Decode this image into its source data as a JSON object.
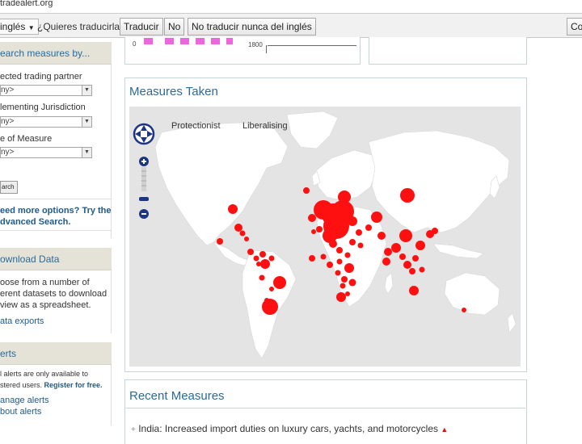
{
  "url": "tradealert.org",
  "translate_bar": {
    "language": "inglés",
    "question": "¿Quieres traducirla?",
    "translate_button": "Traducir",
    "no_button": "No",
    "never_button": "No traducir nunca del inglés",
    "right_button": "Con"
  },
  "sidebar": {
    "search_header": "earch measures by...",
    "trading_partner_label": "ected trading partner",
    "trading_partner_value": "ny>",
    "jurisdiction_label": "lementing Jurisdiction",
    "jurisdiction_value": "ny>",
    "type_label": "e of Measure",
    "type_value": "ny>",
    "search_button": "arch",
    "more_options_line1": "eed more options? Try the",
    "more_options_line2": "dvanced Search.",
    "download_header": "ownload Data",
    "download_text_1": "oose from a number of",
    "download_text_2": "erent datasets to download",
    "download_text_3": "view as a spreadsheet.",
    "data_exports_link": "ata exports",
    "alerts_header": "erts",
    "alerts_text_1": "l alerts are only available to",
    "alerts_text_2a": "stered users. ",
    "alerts_text_2b": "Register for free.",
    "manage_alerts_link": "anage alerts",
    "about_alerts_link": "bout alerts"
  },
  "top_chart": {
    "axis_left": "0",
    "axis_right": "1800",
    "bar_color": "#ee66dd"
  },
  "measures_taken": {
    "title": "Measures Taken",
    "legend_protectionist": "Protectionist",
    "legend_liberalising": "Liberalising",
    "marker_color": "#ff1010",
    "map_background": "#e4e4e4",
    "land_color": "#ffffff"
  },
  "recent_measures": {
    "title": "Recent Measures",
    "item_1": "India: Increased import duties on luxury cars, yachts, and motorcycles"
  }
}
